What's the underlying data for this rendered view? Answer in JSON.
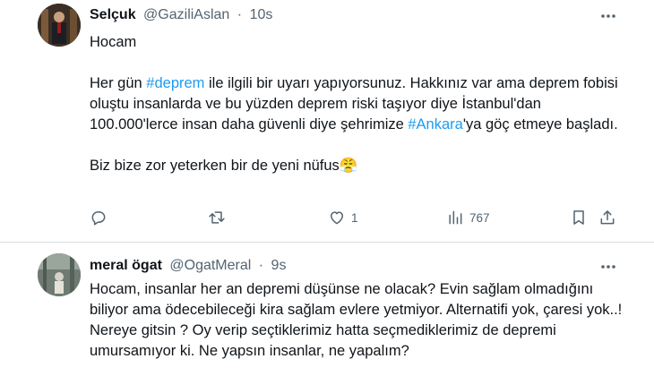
{
  "tweets": [
    {
      "name": "Selçuk",
      "handle": "@GaziliAslan",
      "sep": "·",
      "time": "10s",
      "body": {
        "line1": "Hocam",
        "p2_a": "Her gün ",
        "p2_tag1": "#deprem",
        "p2_b": " ile ilgili bir uyarı yapıyorsunuz. Hakkınız var ama deprem fobisi oluştu insanlarda ve bu yüzden deprem riski taşıyor diye İstanbul'dan 100.000'lerce insan daha güvenli diye şehrimize ",
        "p2_tag2": "#Ankara",
        "p2_c": "'ya göç etmeye başladı.",
        "p3": "Biz bize zor yeterken bir de yeni nüfus",
        "emoji": "😤"
      },
      "actions": {
        "reply_icon": "reply-icon",
        "retweet_icon": "retweet-icon",
        "like_icon": "heart-icon",
        "like_count": "1",
        "views_icon": "views-icon",
        "views_count": "767",
        "bookmark_icon": "bookmark-icon",
        "share_icon": "share-icon"
      }
    },
    {
      "name": "meral ögat",
      "handle": "@OgatMeral",
      "sep": "·",
      "time": "9s",
      "body": "Hocam, insanlar her an depremi düşünse ne olacak? Evin sağlam olmadığını biliyor ama ödecebileceği kira sağlam evlere yetmiyor. Alternatifi yok, çaresi yok..! Nereye gitsin ? Oy verip seçtiklerimiz hatta seçmediklerimiz de depremi umursamıyor ki. Ne yapsın insanlar, ne yapalım?"
    }
  ],
  "colors": {
    "text": "#0f1419",
    "secondary": "#536471",
    "hashtag": "#1d9bf0",
    "divider": "#d9dde1"
  }
}
